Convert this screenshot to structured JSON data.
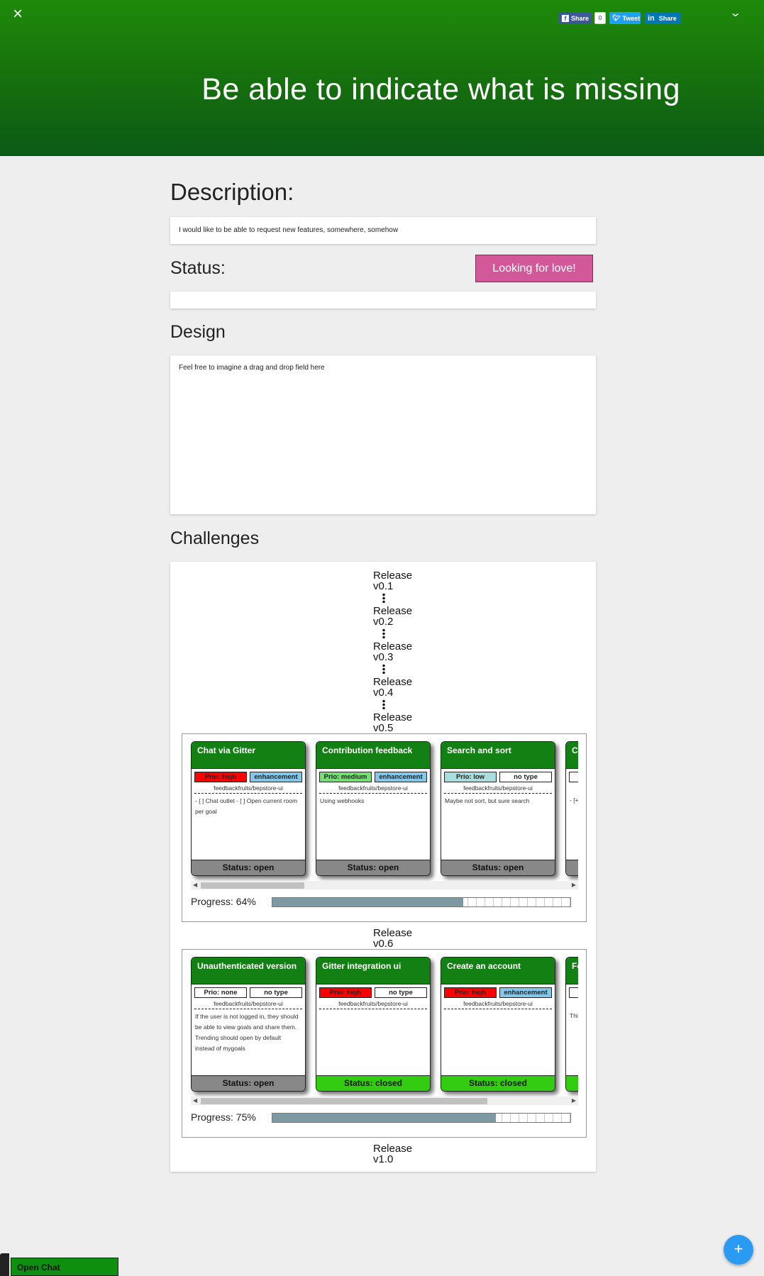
{
  "header": {
    "close_icon": "×",
    "collapse_icon": "⌄",
    "title": "Be able to indicate what is missing",
    "social": {
      "facebook_label": "Share",
      "facebook_count": "0",
      "twitter_label": "Tweet",
      "linkedin_label": "Share"
    }
  },
  "description": {
    "heading": "Description:",
    "text": "I would like to be able to request new features, somewhere, somehow"
  },
  "status": {
    "heading": "Status:",
    "badge": "Looking for love!"
  },
  "design": {
    "heading": "Design",
    "text": "Feel free to imagine a drag and drop field here"
  },
  "challenges": {
    "heading": "Challenges",
    "releases": [
      {
        "line1": "Release",
        "line2": "v0.1"
      },
      {
        "line1": "Release",
        "line2": "v0.2"
      },
      {
        "line1": "Release",
        "line2": "v0.3"
      },
      {
        "line1": "Release",
        "line2": "v0.4"
      },
      {
        "line1": "Release",
        "line2": "v0.5"
      },
      {
        "line1": "Release",
        "line2": "v0.6"
      },
      {
        "line1": "Release",
        "line2": "v1.0"
      }
    ],
    "groups": [
      {
        "progress_label": "Progress: 64%",
        "progress": 0.64,
        "cards": [
          {
            "title": "Chat via Gitter",
            "prio": "Prio: high",
            "type": "enhancement",
            "repo": "feedbackfruits/bepstore-ui",
            "body": "- [ ] Chat outlet - [ ] Open current room per goal",
            "status": "Status: open"
          },
          {
            "title": "Contribution feedback",
            "prio": "Prio: medium",
            "type": "enhancement",
            "repo": "feedbackfruits/bepstore-ui",
            "body": "Using webhooks",
            "status": "Status: open"
          },
          {
            "title": "Search and sort",
            "prio": "Prio: low",
            "type": "no type",
            "repo": "feedbackfruits/bepstore-ui",
            "body": "Maybe not sort, but sure search",
            "status": "Status: open"
          },
          {
            "title": "C p",
            "prio": "",
            "type": "",
            "repo": "",
            "body": "- [+ [+]",
            "status": ""
          }
        ]
      },
      {
        "progress_label": "Progress: 75%",
        "progress": 0.75,
        "cards": [
          {
            "title": "Unauthenticated version",
            "prio": "Prio: none",
            "type": "no type",
            "repo": "feedbackfruits/bepstore-ui",
            "body": "If the user is not logged in, they should be able to view goals and share them. Trending should open by default instead of mygoals",
            "status": "Status: open"
          },
          {
            "title": "Gitter integration ui",
            "prio": "Prio: high",
            "type": "no type",
            "repo": "feedbackfruits/bepstore-ui",
            "body": "",
            "status": "Status: closed"
          },
          {
            "title": "Create an account",
            "prio": "Prio: high",
            "type": "enhancement",
            "repo": "feedbackfruits/bepstore-ui",
            "body": "",
            "status": "Status: closed"
          },
          {
            "title": "Fe",
            "prio": "",
            "type": "",
            "repo": "",
            "body": "Thi and api me api fee",
            "status": ""
          }
        ]
      }
    ]
  },
  "footer": {
    "chat_label": "Open Chat",
    "fab_icon": "+"
  },
  "colors": {
    "header_green": "#1e8a0a",
    "card_green": "#128012",
    "status_badge": "#d3589a",
    "prio_high": "#ff0000",
    "prio_medium": "#77dd77",
    "prio_low": "#aadddd",
    "enhancement": "#84c7e8",
    "closed": "#33cc11",
    "fab": "#2b9af3"
  }
}
